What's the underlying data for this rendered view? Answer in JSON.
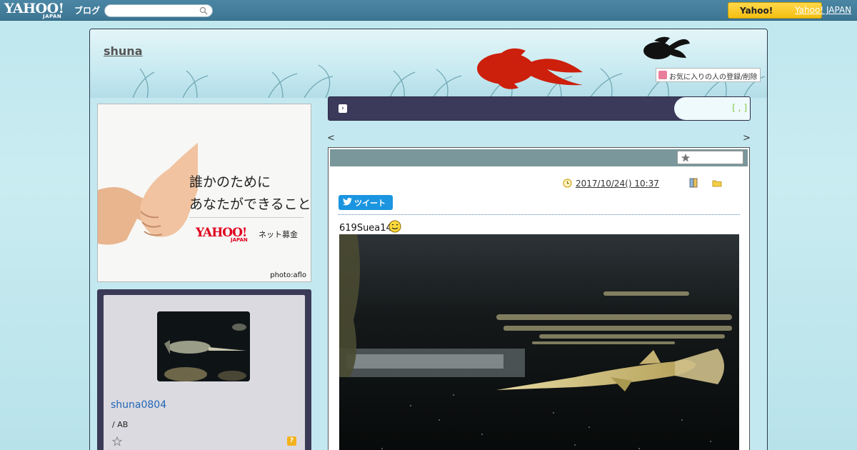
{
  "topbar": {
    "logo_main": "YAHOO!",
    "logo_sub": "JAPAN",
    "logo_blog": "ブログ",
    "search_placeholder": "",
    "yahoo_button": "Yahoo!",
    "yahoo_japan_link": "Yahoo! JAPAN"
  },
  "blog": {
    "title": "shuna",
    "favorite_button": "お気に入りの人の登録/削除"
  },
  "ad": {
    "line1": "誰かのために",
    "line2": "あなたができること",
    "brand": "YAHOO!",
    "brand_sub": "JAPAN",
    "service": "ネット募金",
    "credit": "photo:aflo"
  },
  "profile": {
    "name": "shuna0804",
    "sub": "/ AB",
    "q_icon": "?"
  },
  "notice": {
    "arrow": "›",
    "bracket": "[ , ]"
  },
  "pager": {
    "prev": "<",
    "next": ">"
  },
  "post": {
    "date": "2017/10/24()  10:37",
    "folder_link": "",
    "tweet_label": "ツイート",
    "text": "619Suea14"
  },
  "colors": {
    "topbar": "#4a86a4",
    "notice_bg": "#3b3a5b",
    "post_header": "#7a979b",
    "profile_name": "#1f66b4",
    "tweet": "#1b95e0"
  }
}
